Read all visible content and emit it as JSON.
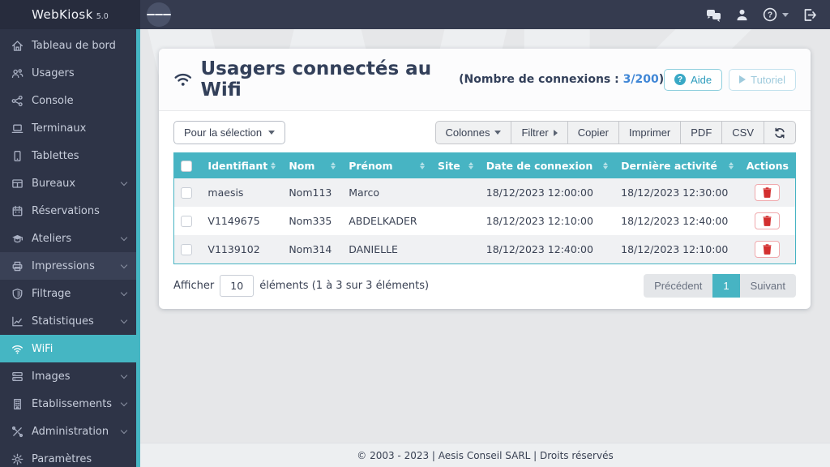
{
  "brand": {
    "name": "WebKiosk",
    "version": "5.0"
  },
  "topbar": {
    "icons": [
      "messages-icon",
      "user-icon",
      "help-icon",
      "logout-icon"
    ]
  },
  "sidebar": {
    "items": [
      {
        "label": "Tableau de bord",
        "icon": "home-icon",
        "expandable": false
      },
      {
        "label": "Usagers",
        "icon": "users-icon",
        "expandable": false
      },
      {
        "label": "Console",
        "icon": "console-icon",
        "expandable": false
      },
      {
        "label": "Terminaux",
        "icon": "laptop-icon",
        "expandable": false
      },
      {
        "label": "Tablettes",
        "icon": "tablet-icon",
        "expandable": false
      },
      {
        "label": "Bureaux",
        "icon": "desks-icon",
        "expandable": true
      },
      {
        "label": "Réservations",
        "icon": "calendar-icon",
        "expandable": false
      },
      {
        "label": "Ateliers",
        "icon": "graduation-cap-icon",
        "expandable": true
      },
      {
        "label": "Impressions",
        "icon": "printer-icon",
        "expandable": true
      },
      {
        "label": "Filtrage",
        "icon": "shield-icon",
        "expandable": true
      },
      {
        "label": "Statistiques",
        "icon": "chart-icon",
        "expandable": true
      },
      {
        "label": "WiFi",
        "icon": "wifi-icon",
        "expandable": false,
        "active": true
      },
      {
        "label": "Images",
        "icon": "server-icon",
        "expandable": true
      },
      {
        "label": "Établissements",
        "icon": "building-icon",
        "expandable": true
      },
      {
        "label": "Administration",
        "icon": "tools-icon",
        "expandable": true
      },
      {
        "label": "Paramètres",
        "icon": "gear-icon",
        "expandable": false
      }
    ]
  },
  "page": {
    "title": "Usagers connectés au Wifi",
    "subtitle_prefix": "(Nombre de connexions : ",
    "count": "3/200",
    "subtitle_suffix": ")",
    "aide_label": "Aide",
    "tutoriel_label": "Tutoriel"
  },
  "toolbar": {
    "selection_label": "Pour la sélection",
    "buttons": [
      "Colonnes",
      "Filtrer",
      "Copier",
      "Imprimer",
      "PDF",
      "CSV"
    ],
    "refresh_icon": "refresh-icon"
  },
  "table": {
    "headers": [
      "Identifiant",
      "Nom",
      "Prénom",
      "Site",
      "Date de connexion",
      "Dernière activité",
      "Actions"
    ],
    "rows": [
      {
        "identifiant": "maesis",
        "nom": "Nom113",
        "prenom": "Marco",
        "site": "",
        "date_connexion": "18/12/2023 12:00:00",
        "derniere_activite": "18/12/2023 12:30:00"
      },
      {
        "identifiant": "V1149675",
        "nom": "Nom335",
        "prenom": "ABDELKADER",
        "site": "",
        "date_connexion": "18/12/2023 12:10:00",
        "derniere_activite": "18/12/2023 12:40:00"
      },
      {
        "identifiant": "V1139102",
        "nom": "Nom314",
        "prenom": "DANIELLE",
        "site": "",
        "date_connexion": "18/12/2023 12:40:00",
        "derniere_activite": "18/12/2023 12:10:00"
      }
    ]
  },
  "pagination": {
    "afficher_label": "Afficher",
    "page_size": "10",
    "elements_label": "éléments (1 à 3 sur 3 éléments)",
    "previous_label": "Précédent",
    "current_page": "1",
    "next_label": "Suivant"
  },
  "footer": {
    "text": "© 2003 - 2023 | Aesis Conseil SARL | Droits réservés"
  },
  "watermark": "WK",
  "colors": {
    "accent_teal": "#45b6c3",
    "table_header_teal": "#47b4c3",
    "sidebar_bg": "#2e3447",
    "topbar_bg": "#353b4f",
    "count_blue": "#3f86d6",
    "danger_red": "#d32f2f"
  }
}
